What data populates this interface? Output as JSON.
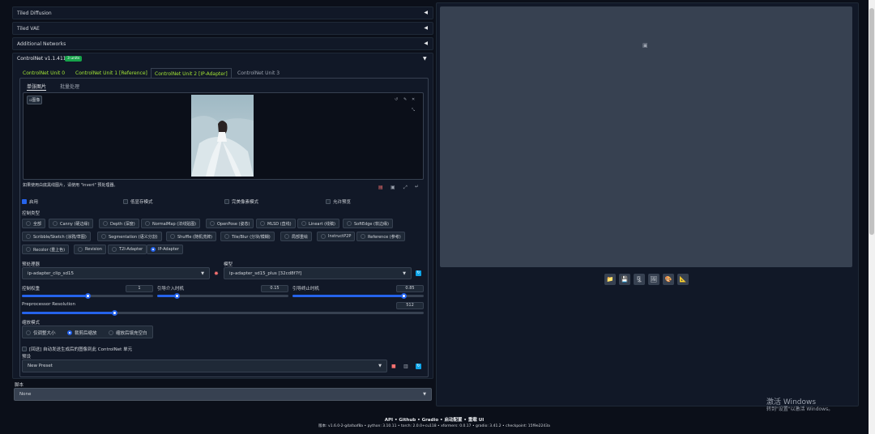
{
  "accordions": [
    {
      "label": "Tiled Diffusion"
    },
    {
      "label": "Tiled VAE"
    },
    {
      "label": "Additional Networks"
    }
  ],
  "controlnet": {
    "title": "ControlNet v1.1.411",
    "badge": "3 units",
    "tabs": [
      "ControlNet Unit 0",
      "ControlNet Unit 1 [Reference]",
      "ControlNet Unit 2 [IP-Adapter]",
      "ControlNet Unit 3"
    ],
    "subtabs": [
      "单张图片",
      "批量处理"
    ],
    "image_tag": "图像",
    "image_hint": "如果使用白底黑线图片，请使用 \"invert\" 预处理器。",
    "options": [
      "启用",
      "低显存模式",
      "完美像素模式",
      "允许预览"
    ],
    "control_type_label": "控制类型",
    "control_types": [
      "全部",
      "Canny (硬边缘)",
      "Depth (深度)",
      "NormalMap (法线贴图)",
      "OpenPose (姿态)",
      "MLSD (直线)",
      "Lineart (线稿)",
      "SoftEdge (软边缘)",
      "Scribble/Sketch (涂鸦/草图)",
      "Segmentation (语义分割)",
      "Shuffle (随机洗牌)",
      "Tile/Blur (分块/模糊)",
      "局部重绘",
      "InstructP2P",
      "Reference (参考)",
      "Recolor (重上色)",
      "Revision",
      "T2I-Adapter",
      "IP-Adapter"
    ],
    "selected_control_type": "IP-Adapter",
    "preprocessor_label": "预处理器",
    "preprocessor_value": "ip-adapter_clip_sd15",
    "model_label": "模型",
    "model_value": "ip-adapter_sd15_plus [32cd8f7f]",
    "weight_label": "控制权重",
    "weight_value": 1,
    "start_label": "引导介入时机",
    "start_value": 0.15,
    "end_label": "引导终止时机",
    "end_value": 0.85,
    "resolution_label": "Preprocessor Resolution",
    "resolution_value": 512,
    "resize_label": "缩放模式",
    "resize_modes": [
      "仅调整大小",
      "裁剪后缩放",
      "缩放后填充空白"
    ],
    "selected_resize": "裁剪后缩放",
    "upload_text": "[回送] 自动发送生成后的图像到此 ControlNet 单元",
    "preset_label": "预设",
    "preset_value": "New Preset"
  },
  "script": {
    "label": "脚本",
    "value": "None"
  },
  "footer": {
    "links": [
      "API",
      "Github",
      "Gradio",
      "启动配置",
      "重载 UI"
    ],
    "version": "版本: v1.6.0-2-g4afaaf8a  •  python: 3.10.11  •  torch: 2.0.0+cu118  •  xformers: 0.0.17  •  gradio: 3.41.2  •  checkpoint: 15f9e2243a"
  },
  "watermark": {
    "title": "激活 Windows",
    "subtitle": "转到\"设置\"以激活 Windows。"
  },
  "output_tools": [
    "folder-icon",
    "save-icon",
    "zip-icon",
    "image-icon",
    "palette-icon",
    "ruler-icon"
  ],
  "colors": {
    "accent": "#2563eb",
    "badge": "#16a34a",
    "tab_active": "#a3e635"
  }
}
